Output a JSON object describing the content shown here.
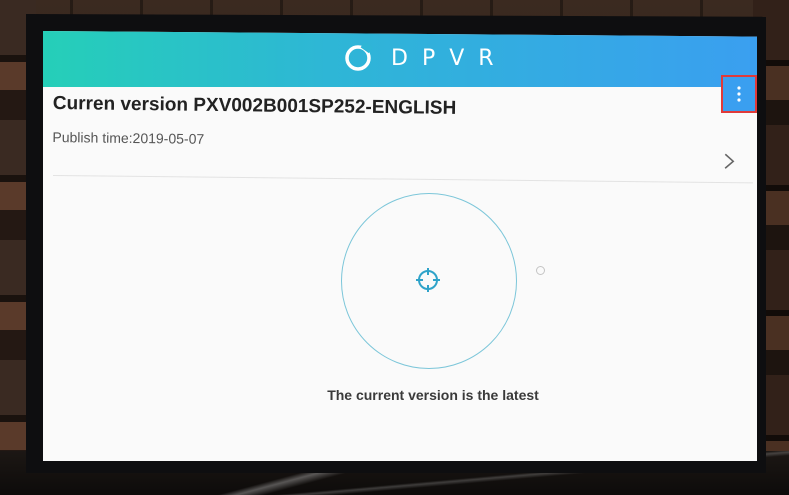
{
  "header": {
    "brand": "DPVR",
    "brand_color": "#3a9ff0",
    "gradient_start": "#25cfb8",
    "menu_icon": "more-vertical-icon",
    "logo_icon": "dpvr-logo-icon"
  },
  "version": {
    "title": "Curren version PXV002B001SP252-ENGLISH",
    "publish_time": "Publish time:2019-05-07",
    "chevron_icon": "chevron-right-icon"
  },
  "update_check": {
    "status": "The current version is the latest",
    "center_icon": "crosshair-icon",
    "ring_color": "#7cc6d9"
  },
  "highlight_color": "#e03a3a"
}
